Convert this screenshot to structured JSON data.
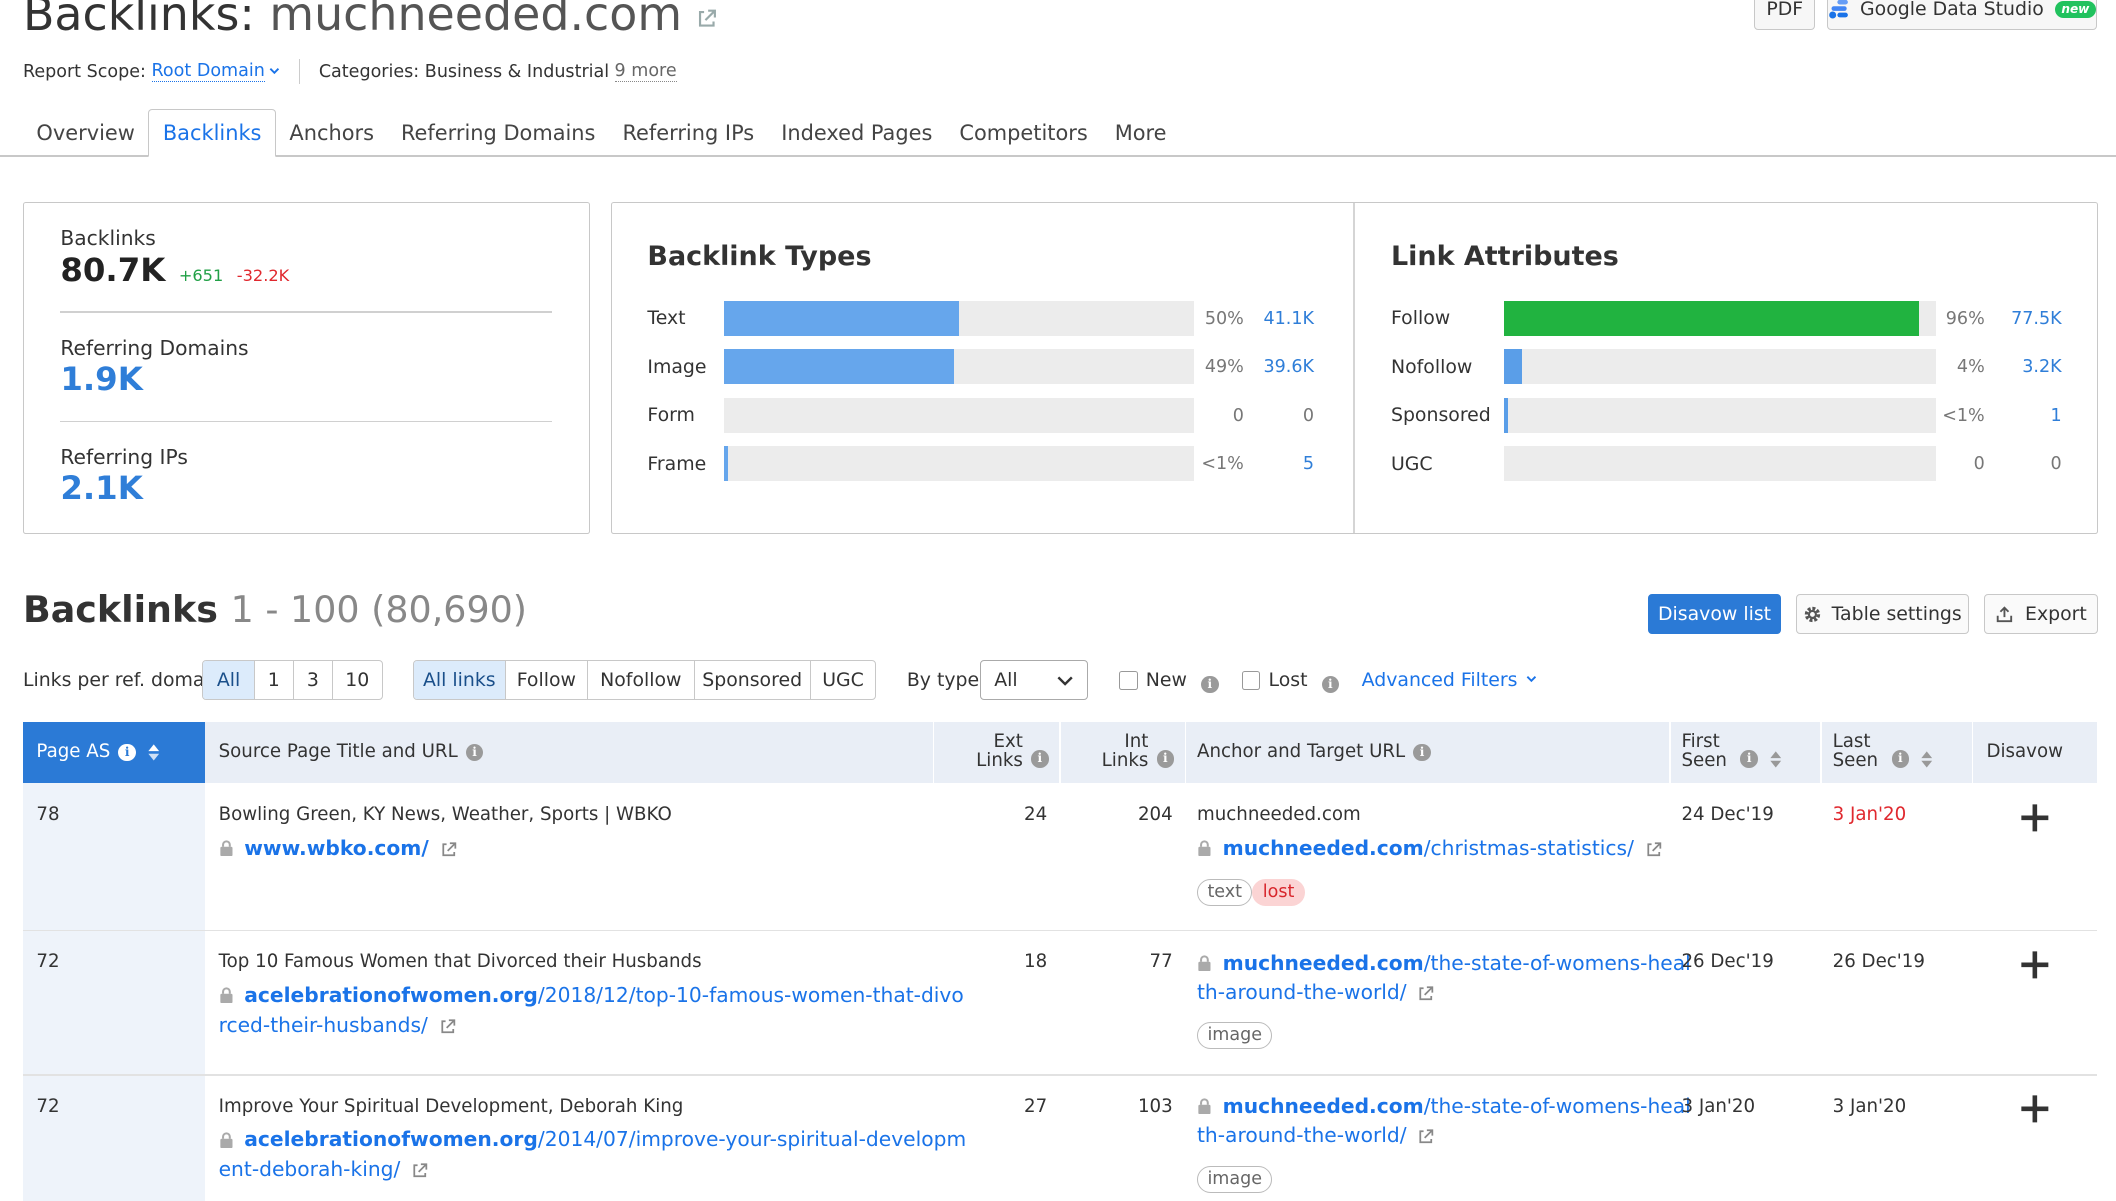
{
  "header": {
    "title_prefix": "Backlinks:",
    "domain": "muchneeded.com",
    "scope_label": "Report Scope:",
    "scope_value": "Root Domain",
    "categories_label": "Categories: Business & Industrial",
    "categories_more": "9 more",
    "pdf_label": "PDF",
    "gds_label": "Google Data Studio",
    "gds_badge": "new"
  },
  "tabs": [
    {
      "label": "Overview"
    },
    {
      "label": "Backlinks"
    },
    {
      "label": "Anchors"
    },
    {
      "label": "Referring Domains"
    },
    {
      "label": "Referring IPs"
    },
    {
      "label": "Indexed Pages"
    },
    {
      "label": "Competitors"
    },
    {
      "label": "More"
    }
  ],
  "summary": {
    "backlinks_label": "Backlinks",
    "backlinks_value": "80.7K",
    "backlinks_pos": "+651",
    "backlinks_neg": "-32.2K",
    "refdomains_label": "Referring Domains",
    "refdomains_value": "1.9K",
    "refips_label": "Referring IPs",
    "refips_value": "2.1K"
  },
  "backlink_types": {
    "title": "Backlink Types",
    "rows": [
      {
        "label": "Text",
        "pct": "50%",
        "count": "41.1K",
        "fraction": 0.5
      },
      {
        "label": "Image",
        "pct": "49%",
        "count": "39.6K",
        "fraction": 0.49
      },
      {
        "label": "Form",
        "pct": "0",
        "count": "0",
        "fraction": 0
      },
      {
        "label": "Frame",
        "pct": "<1%",
        "count": "5",
        "fraction": 0.005
      }
    ]
  },
  "link_attributes": {
    "title": "Link Attributes",
    "rows": [
      {
        "label": "Follow",
        "pct": "96%",
        "count": "77.5K",
        "fraction": 0.96,
        "color": "#21b340"
      },
      {
        "label": "Nofollow",
        "pct": "4%",
        "count": "3.2K",
        "fraction": 0.04,
        "color": "#5a9ee8"
      },
      {
        "label": "Sponsored",
        "pct": "<1%",
        "count": "1",
        "fraction": 0.005,
        "color": "#5a9ee8"
      },
      {
        "label": "UGC",
        "pct": "0",
        "count": "0",
        "fraction": 0,
        "color": "#5a9ee8"
      }
    ]
  },
  "colors": {
    "bar_blue": "#66a6ec",
    "follow_green": "#21b340",
    "accent": "#2b7ad6",
    "lost_red": "#e0282e"
  },
  "section": {
    "title": "Backlinks",
    "range": "1 - 100 (80,690)",
    "disavow_btn": "Disavow list",
    "table_settings_btn": "Table settings",
    "export_btn": "Export"
  },
  "filters": {
    "per_domain_label": "Links per ref. domain",
    "per_domain_opts": [
      "All",
      "1",
      "3",
      "10"
    ],
    "link_opts": [
      "All links",
      "Follow",
      "Nofollow",
      "Sponsored",
      "UGC"
    ],
    "by_type_label": "By type",
    "by_type_value": "All",
    "new_label": "New",
    "lost_label": "Lost",
    "advanced_label": "Advanced Filters"
  },
  "table": {
    "headers": {
      "page_as": "Page AS",
      "source": "Source Page Title and URL",
      "ext1": "Ext",
      "ext2": "Links",
      "int1": "Int",
      "int2": "Links",
      "anchor": "Anchor and Target URL",
      "first1": "First",
      "first2": "Seen",
      "last1": "Last",
      "last2": "Seen",
      "disavow": "Disavow"
    },
    "rows": [
      {
        "as": "78",
        "title": "Bowling Green, KY News, Weather, Sports | WBKO",
        "src_domain": "www.wbko.com/",
        "src_path": "",
        "ext": "24",
        "int": "204",
        "anchor_text": "muchneeded.com",
        "tgt_domain": "muchneeded.com",
        "tgt_path": "/christmas-statistics/",
        "tag": "text",
        "tag2": "lost",
        "first": "24 Dec'19",
        "last": "3 Jan'20"
      },
      {
        "as": "72",
        "title": "Top 10 Famous Women that Divorced their Husbands",
        "src_domain": "acelebrationofwomen.org",
        "src_path_1": "/2018/12/top-10-famous-women-that-divo",
        "src_path_2": "rced-their-husbands/",
        "ext": "18",
        "int": "77",
        "tgt_domain": "muchneeded.com",
        "tgt_path_1": "/the-state-of-womens-heal",
        "tgt_path_2": "th-around-the-world/",
        "tag": "image",
        "first": "26 Dec'19",
        "last": "26 Dec'19"
      },
      {
        "as": "72",
        "title": "Improve Your Spiritual Development, Deborah King",
        "src_domain": "acelebrationofwomen.org",
        "src_path_1": "/2014/07/improve-your-spiritual-developm",
        "src_path_2": "ent-deborah-king/",
        "ext": "27",
        "int": "103",
        "tgt_domain": "muchneeded.com",
        "tgt_path_1": "/the-state-of-womens-heal",
        "tgt_path_2": "th-around-the-world/",
        "tag": "image",
        "first": "3 Jan'20",
        "last": "3 Jan'20"
      }
    ]
  }
}
